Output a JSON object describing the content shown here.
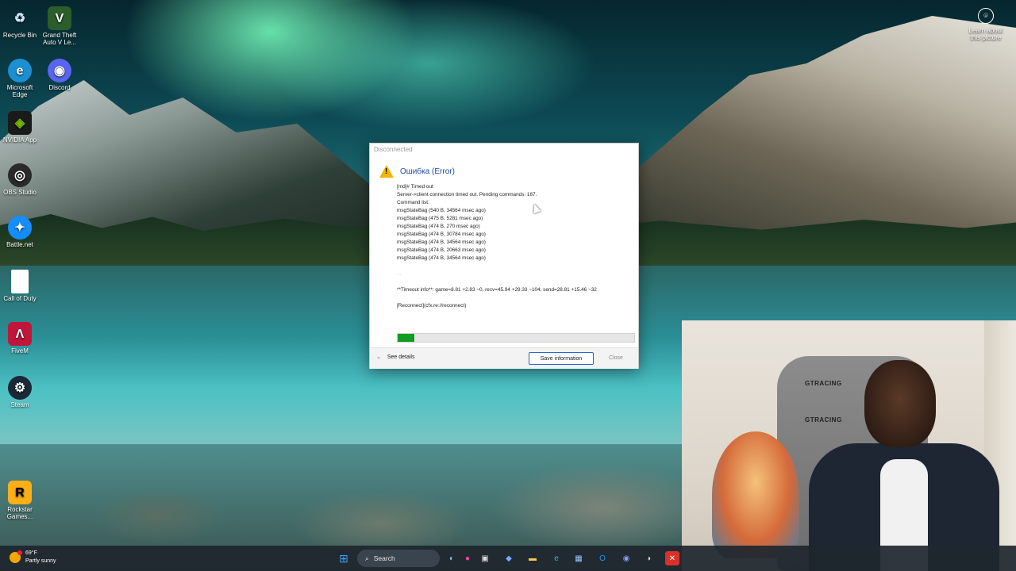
{
  "desktop_icons": [
    {
      "label": "Recycle Bin",
      "icon": "recycle-bin-icon",
      "color": "#3a8fd6"
    },
    {
      "label": "Grand Theft Auto V Le...",
      "icon": "gta-v-icon",
      "color": "#2b5e2a"
    },
    {
      "label": "Microsoft Edge",
      "icon": "edge-icon",
      "color": "#1b8fd0"
    },
    {
      "label": "Discord",
      "icon": "discord-icon",
      "color": "#5865f2"
    },
    {
      "label": "NVIDIA App",
      "icon": "nvidia-icon",
      "color": "#76b900"
    },
    {
      "label": "OBS Studio",
      "icon": "obs-icon",
      "color": "#2a2a2a"
    },
    {
      "label": "Battle.net",
      "icon": "battlenet-icon",
      "color": "#148eff"
    },
    {
      "label": "Call of Duty",
      "icon": "file-icon",
      "color": "#ffffff"
    },
    {
      "label": "FiveM",
      "icon": "fivem-icon",
      "color": "#c0163a"
    },
    {
      "label": "Steam",
      "icon": "steam-icon",
      "color": "#1b2838"
    },
    {
      "label": "Rockstar Games...",
      "icon": "rockstar-icon",
      "color": "#fcaf17"
    }
  ],
  "learn": {
    "label": "Learn about this picture"
  },
  "dialog": {
    "title": "Disconnected",
    "heading": "Ошибка (Error)",
    "lines": [
      "[md]# Timed out",
      "Server->client connection timed out. Pending commands: 167.",
      "Command list:",
      "msgStateBag (540 B, 34564 msec ago)",
      "msgStateBag (475 B, 5281 msec ago)",
      "msgStateBag (474 B, 270 msec ago)",
      "msgStateBag (474 B, 30784 msec ago)",
      "msgStateBag (474 B, 34564 msec ago)",
      "msgStateBag (474 B, 20663 msec ago)",
      "msgStateBag (474 B, 34564 msec ago)"
    ],
    "dots": "...",
    "timeout_info": "**Timeout info**: game=8.81 +2.83 ~0, recv=45.94 +29.33 ~104, send=28.81 +15.46 ~32",
    "reconnect": "[Reconnect](cfx.re://reconnect)",
    "progress": 0.07,
    "see_details": "See details",
    "save_button": "Save information",
    "close_button": "Close"
  },
  "webcam": {
    "chair_brand_top": "GTRACING",
    "chair_brand_bottom": "GTRACING"
  },
  "taskbar": {
    "weather_temp": "69°F",
    "weather_desc": "Partly sunny",
    "search_placeholder": "Search",
    "apps": [
      "start-icon",
      "search-icon",
      "widgets-icon",
      "file-explorer-icon",
      "copilot-icon",
      "folder-icon",
      "edge-icon",
      "store-icon",
      "outlook-icon",
      "discord-icon",
      "rockstar-icon",
      "fivem-icon"
    ]
  },
  "colors": {
    "accent": "#2a67c9",
    "progress": "#0e9c22",
    "warning": "#f2b600",
    "heading": "#1e4aa8"
  }
}
